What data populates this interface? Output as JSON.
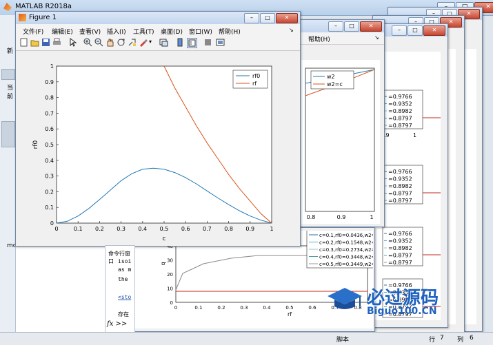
{
  "app": {
    "title": "MATLAB R2018a"
  },
  "figure": {
    "title": "Figure 1",
    "menu": [
      "文件(F)",
      "编辑(E)",
      "查看(V)",
      "插入(I)",
      "工具(T)",
      "桌面(D)",
      "窗口(W)",
      "帮助(H)"
    ],
    "help_menu_fragment": "帮助(H)"
  },
  "chart_data": [
    {
      "type": "line",
      "xlabel": "c",
      "ylabel": "rf0",
      "xlim": [
        0,
        1
      ],
      "ylim": [
        0,
        1
      ],
      "xticks": [
        "0",
        "0.1",
        "0.2",
        "0.3",
        "0.4",
        "0.5",
        "0.6",
        "0.7",
        "0.8",
        "0.9",
        "1"
      ],
      "yticks": [
        "0",
        "0.1",
        "0.2",
        "0.3",
        "0.4",
        "0.5",
        "0.6",
        "0.7",
        "0.8",
        "0.9",
        "1"
      ],
      "legend_position": "top-right",
      "series": [
        {
          "name": "rf0",
          "color": "#1f77b4",
          "x": [
            0,
            0.05,
            0.1,
            0.15,
            0.2,
            0.25,
            0.3,
            0.35,
            0.4,
            0.45,
            0.5,
            0.55,
            0.6,
            0.65,
            0.7,
            0.75,
            0.8,
            0.85,
            0.9,
            0.95,
            1
          ],
          "y": [
            0,
            0.012,
            0.045,
            0.093,
            0.15,
            0.21,
            0.27,
            0.315,
            0.343,
            0.35,
            0.343,
            0.322,
            0.29,
            0.25,
            0.205,
            0.16,
            0.118,
            0.079,
            0.045,
            0.019,
            0
          ]
        },
        {
          "name": "rf",
          "color": "#d95319",
          "x": [
            0.5,
            0.55,
            0.6,
            0.65,
            0.7,
            0.75,
            0.8,
            0.85,
            0.9,
            0.95,
            1
          ],
          "y": [
            1,
            0.86,
            0.74,
            0.62,
            0.51,
            0.41,
            0.31,
            0.22,
            0.14,
            0.06,
            0
          ]
        }
      ]
    },
    {
      "type": "line",
      "xlabel": "c",
      "xticks": [
        "0.8",
        "0.9",
        "1"
      ],
      "legend": [
        "w2",
        "w2=c"
      ]
    },
    {
      "type": "line",
      "xlabel": "rf",
      "ylabel": "q",
      "xticks": [
        "0",
        "0.1",
        "0.2",
        "0.3",
        "0.4",
        "0.5",
        "0.6",
        "0.7",
        "0.8",
        "0.9",
        "1"
      ],
      "yticks": [
        "0",
        "10",
        "20",
        "30",
        "40"
      ],
      "legend": [
        "c=0.1,rf0=0.0436,w2=0.9766",
        "c=0.2,rf0=0.1548,w2=0.9352",
        "c=0.3,rf0=0.2734,w2=0.8982",
        "c=0.4,rf0=0.3448,w2=0.8797",
        "c=0.5,rf0=0.3449,w2=0.8797"
      ]
    }
  ],
  "back_legends": {
    "rows": [
      "0.9766",
      "0.9352",
      "0.8982",
      "0.8797",
      "0.8797"
    ],
    "axis_ticks": [
      ".9",
      "1"
    ]
  },
  "command_window": {
    "label": "命令行窗口",
    "lines": [
      "isoi",
      "as m",
      "the",
      "<sto",
      "存在"
    ],
    "prompt": "fx >>"
  },
  "status": {
    "script": "脚本",
    "row_label": "行",
    "row": "7",
    "col_label": "列",
    "col": "6"
  },
  "side_labels": {
    "new": "新",
    "current": "当前",
    "mode": "mo"
  },
  "watermark": {
    "text": "必过源码",
    "url": "Biguo100.CN"
  },
  "ui_colors": {
    "accent": "#c7402a",
    "titlebar": "#c3d6ee"
  }
}
